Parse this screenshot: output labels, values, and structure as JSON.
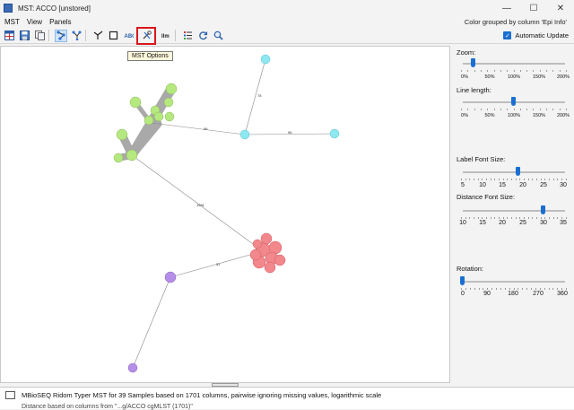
{
  "window": {
    "title": "MST: ACCO [unstored]",
    "controls": {
      "minimize": "—",
      "maximize": "☐",
      "close": "✕"
    }
  },
  "menu": {
    "items": [
      "MST",
      "View",
      "Panels"
    ],
    "color_info": "Color grouped by column 'Epi Info'"
  },
  "toolbar": {
    "tooltip": "MST Options",
    "auto_update_label": "Automatic Update",
    "auto_update_checked": true,
    "icons": [
      "grid-icon",
      "save-icon",
      "copy-icon",
      "network-icon",
      "network-alt-icon",
      "branch-icon",
      "square-icon",
      "label-icon",
      "options-icon",
      "legend-icon",
      "list-icon",
      "sync-icon",
      "search-icon"
    ]
  },
  "side_panel": {
    "zoom": {
      "label": "Zoom:",
      "scale": [
        "0%",
        "50%",
        "100%",
        "150%",
        "200%"
      ],
      "value_pct": 10
    },
    "line_length": {
      "label": "Line length:",
      "scale": [
        "0%",
        "50%",
        "100%",
        "150%",
        "200%"
      ],
      "value_pct": 100
    },
    "label_font": {
      "label": "Label Font Size:",
      "scale": [
        "5",
        "10",
        "15",
        "20",
        "25",
        "30"
      ],
      "value": 19
    },
    "distance_font": {
      "label": "Distance Font Size:",
      "scale": [
        "10",
        "15",
        "20",
        "25",
        "30",
        "35"
      ],
      "value": 30
    },
    "rotation": {
      "label": "Rotation:",
      "scale": [
        "0",
        "90",
        "180",
        "270",
        "360"
      ],
      "value": 0
    }
  },
  "graph": {
    "colors": {
      "green": "#b6e880",
      "cyan": "#8de8f0",
      "red": "#f2878c",
      "purple": "#b58ee8",
      "edge": "#888888",
      "branch": "#a9a9a9"
    },
    "edge_labels": [
      "78",
      "96",
      "96",
      "1581",
      "31"
    ]
  },
  "info": {
    "line1": "MBioSEQ Ridom Typer MST for 39 Samples based on 1701 columns, pairwise ignoring missing values, logarithmic scale",
    "line2": "Distance based on columns from \"...g/ACCO cgMLST (1701)\""
  }
}
